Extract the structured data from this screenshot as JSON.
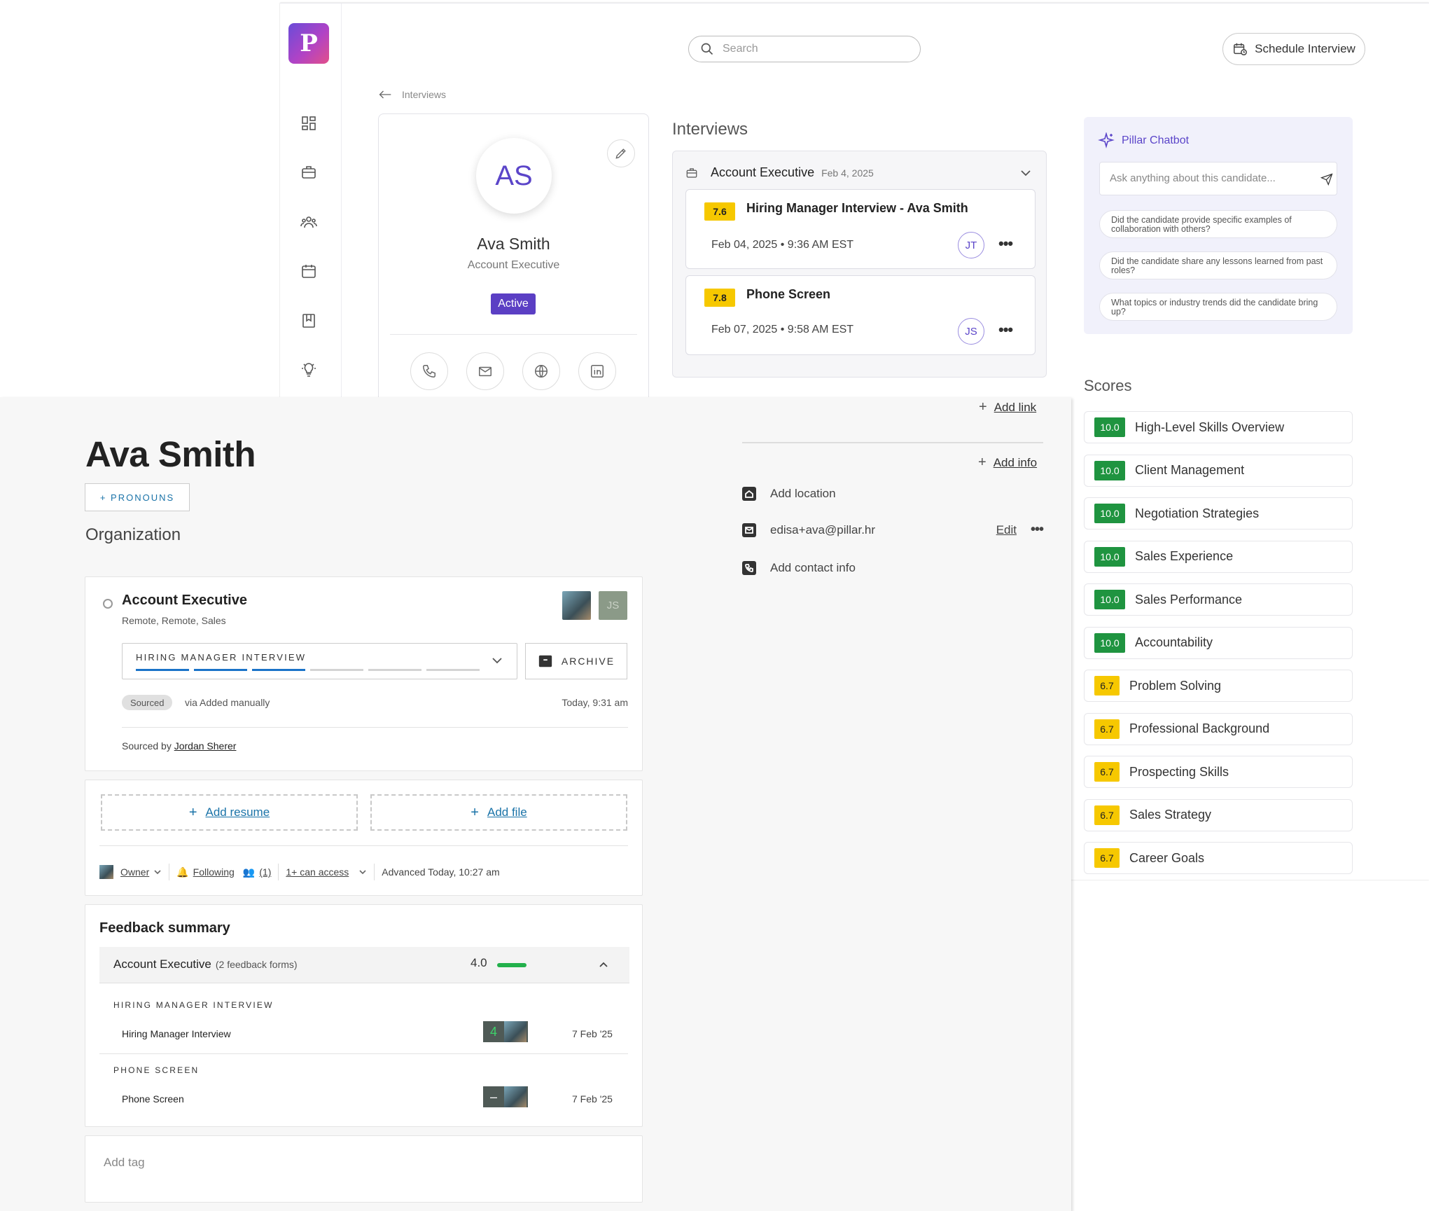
{
  "app": {
    "logo_letter": "P",
    "search_placeholder": "Search",
    "schedule_label": "Schedule Interview",
    "breadcrumb": "Interviews",
    "sidebar_icons": [
      "dashboard-icon",
      "briefcase-icon",
      "people-icon",
      "calendar-icon",
      "book-icon",
      "lightbulb-icon"
    ]
  },
  "profile": {
    "initials": "AS",
    "name": "Ava Smith",
    "role": "Account Executive",
    "status": "Active",
    "contact_icons": [
      "phone-icon",
      "mail-icon",
      "globe-icon",
      "linkedin-icon"
    ]
  },
  "interviews": {
    "heading": "Interviews",
    "group": {
      "title": "Account Executive",
      "date": "Feb 4, 2025"
    },
    "items": [
      {
        "score": "7.6",
        "title": "Hiring Manager Interview - Ava Smith",
        "when": "Feb 04, 2025 • 9:36 AM EST",
        "interviewer": "JT"
      },
      {
        "score": "7.8",
        "title": "Phone Screen",
        "when": "Feb 07, 2025 • 9:58 AM EST",
        "interviewer": "JS"
      }
    ]
  },
  "chatbot": {
    "title": "Pillar Chatbot",
    "placeholder": "Ask anything about this candidate...",
    "suggestions": [
      "Did the candidate provide specific examples of collaboration with others?",
      "Did the candidate share any lessons learned from past roles?",
      "What topics or industry trends did the candidate bring up?"
    ]
  },
  "scores": {
    "heading": "Scores",
    "items": [
      {
        "value": "10.0",
        "label": "High-Level Skills Overview",
        "level": "green"
      },
      {
        "value": "10.0",
        "label": "Client Management",
        "level": "green"
      },
      {
        "value": "10.0",
        "label": "Negotiation Strategies",
        "level": "green"
      },
      {
        "value": "10.0",
        "label": "Sales Experience",
        "level": "green"
      },
      {
        "value": "10.0",
        "label": "Sales Performance",
        "level": "green"
      },
      {
        "value": "10.0",
        "label": "Accountability",
        "level": "green"
      },
      {
        "value": "6.7",
        "label": "Problem Solving",
        "level": "yellow"
      },
      {
        "value": "6.7",
        "label": "Professional Background",
        "level": "yellow"
      },
      {
        "value": "6.7",
        "label": "Prospecting Skills",
        "level": "yellow"
      },
      {
        "value": "6.7",
        "label": "Sales Strategy",
        "level": "yellow"
      },
      {
        "value": "6.7",
        "label": "Career Goals",
        "level": "yellow"
      }
    ]
  },
  "ats": {
    "candidate_name": "Ava Smith",
    "pronouns_btn": "+ PRONOUNS",
    "organization": "Organization",
    "job": {
      "title": "Account Executive",
      "location": "Remote, Remote, Sales",
      "second_avatar_initials": "JS",
      "stage": "HIRING MANAGER INTERVIEW",
      "stage_progress": {
        "completed": 3,
        "total": 6
      },
      "archive": "ARCHIVE",
      "source_pill": "Sourced",
      "source_via": "via Added manually",
      "source_time": "Today, 9:31 am",
      "sourced_by_prefix": "Sourced by",
      "sourced_by_name": "Jordan Sherer"
    },
    "files": {
      "add_resume": "Add resume",
      "add_file": "Add file"
    },
    "meta": {
      "owner": "Owner",
      "following": "Following",
      "followers": "(1)",
      "access": "1+ can access",
      "advanced": "Advanced Today, 10:27 am"
    },
    "feedback": {
      "title": "Feedback summary",
      "job": "Account Executive",
      "forms": "(2 feedback forms)",
      "score": "4.0",
      "sections": [
        {
          "heading": "HIRING MANAGER INTERVIEW",
          "name": "Hiring Manager Interview",
          "rating": "4",
          "date": "7 Feb '25"
        },
        {
          "heading": "PHONE SCREEN",
          "name": "Phone Screen",
          "rating": "–",
          "date": "7 Feb '25"
        }
      ]
    },
    "add_tag": "Add tag",
    "right": {
      "add_link": "Add link",
      "add_info": "Add info",
      "add_location": "Add location",
      "email": "edisa+ava@pillar.hr",
      "edit": "Edit",
      "add_contact": "Add contact info"
    }
  },
  "colors": {
    "accent": "#5b3fc4",
    "score_green": "#1f9440",
    "score_yellow": "#f6c800",
    "link_blue": "#1a73a8"
  }
}
